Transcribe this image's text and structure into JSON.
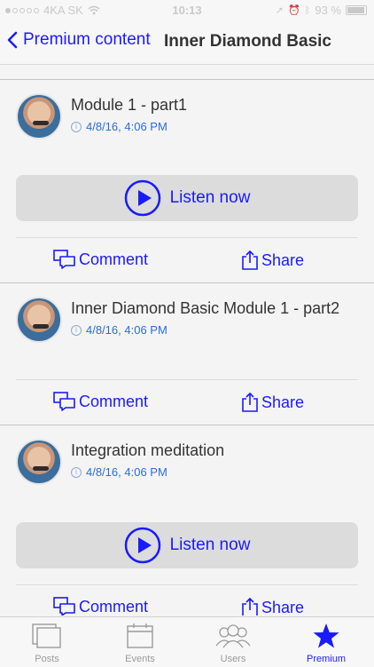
{
  "status_bar": {
    "carrier": "4KA SK",
    "time": "10:13",
    "battery": "93 %"
  },
  "nav": {
    "back_label": "Premium content",
    "title": "Inner Diamond Basic"
  },
  "posts": [
    {
      "title": "Module 1 - part1",
      "date": "4/8/16, 4:06 PM",
      "listen_label": "Listen now",
      "comment_label": "Comment",
      "share_label": "Share"
    },
    {
      "title": "Inner Diamond Basic Module 1 - part2",
      "date": "4/8/16, 4:06 PM",
      "comment_label": "Comment",
      "share_label": "Share"
    },
    {
      "title": "Integration meditation",
      "date": "4/8/16, 4:06 PM",
      "listen_label": "Listen now",
      "comment_label": "Comment",
      "share_label": "Share"
    }
  ],
  "tabs": [
    {
      "label": "Posts",
      "icon": "posts-icon"
    },
    {
      "label": "Events",
      "icon": "calendar-icon"
    },
    {
      "label": "Users",
      "icon": "users-icon"
    },
    {
      "label": "Premium",
      "icon": "star-icon",
      "active": true
    }
  ],
  "colors": {
    "accent": "#1a1aff",
    "date": "#2a6de0",
    "button_bg": "#dcdcdc"
  }
}
